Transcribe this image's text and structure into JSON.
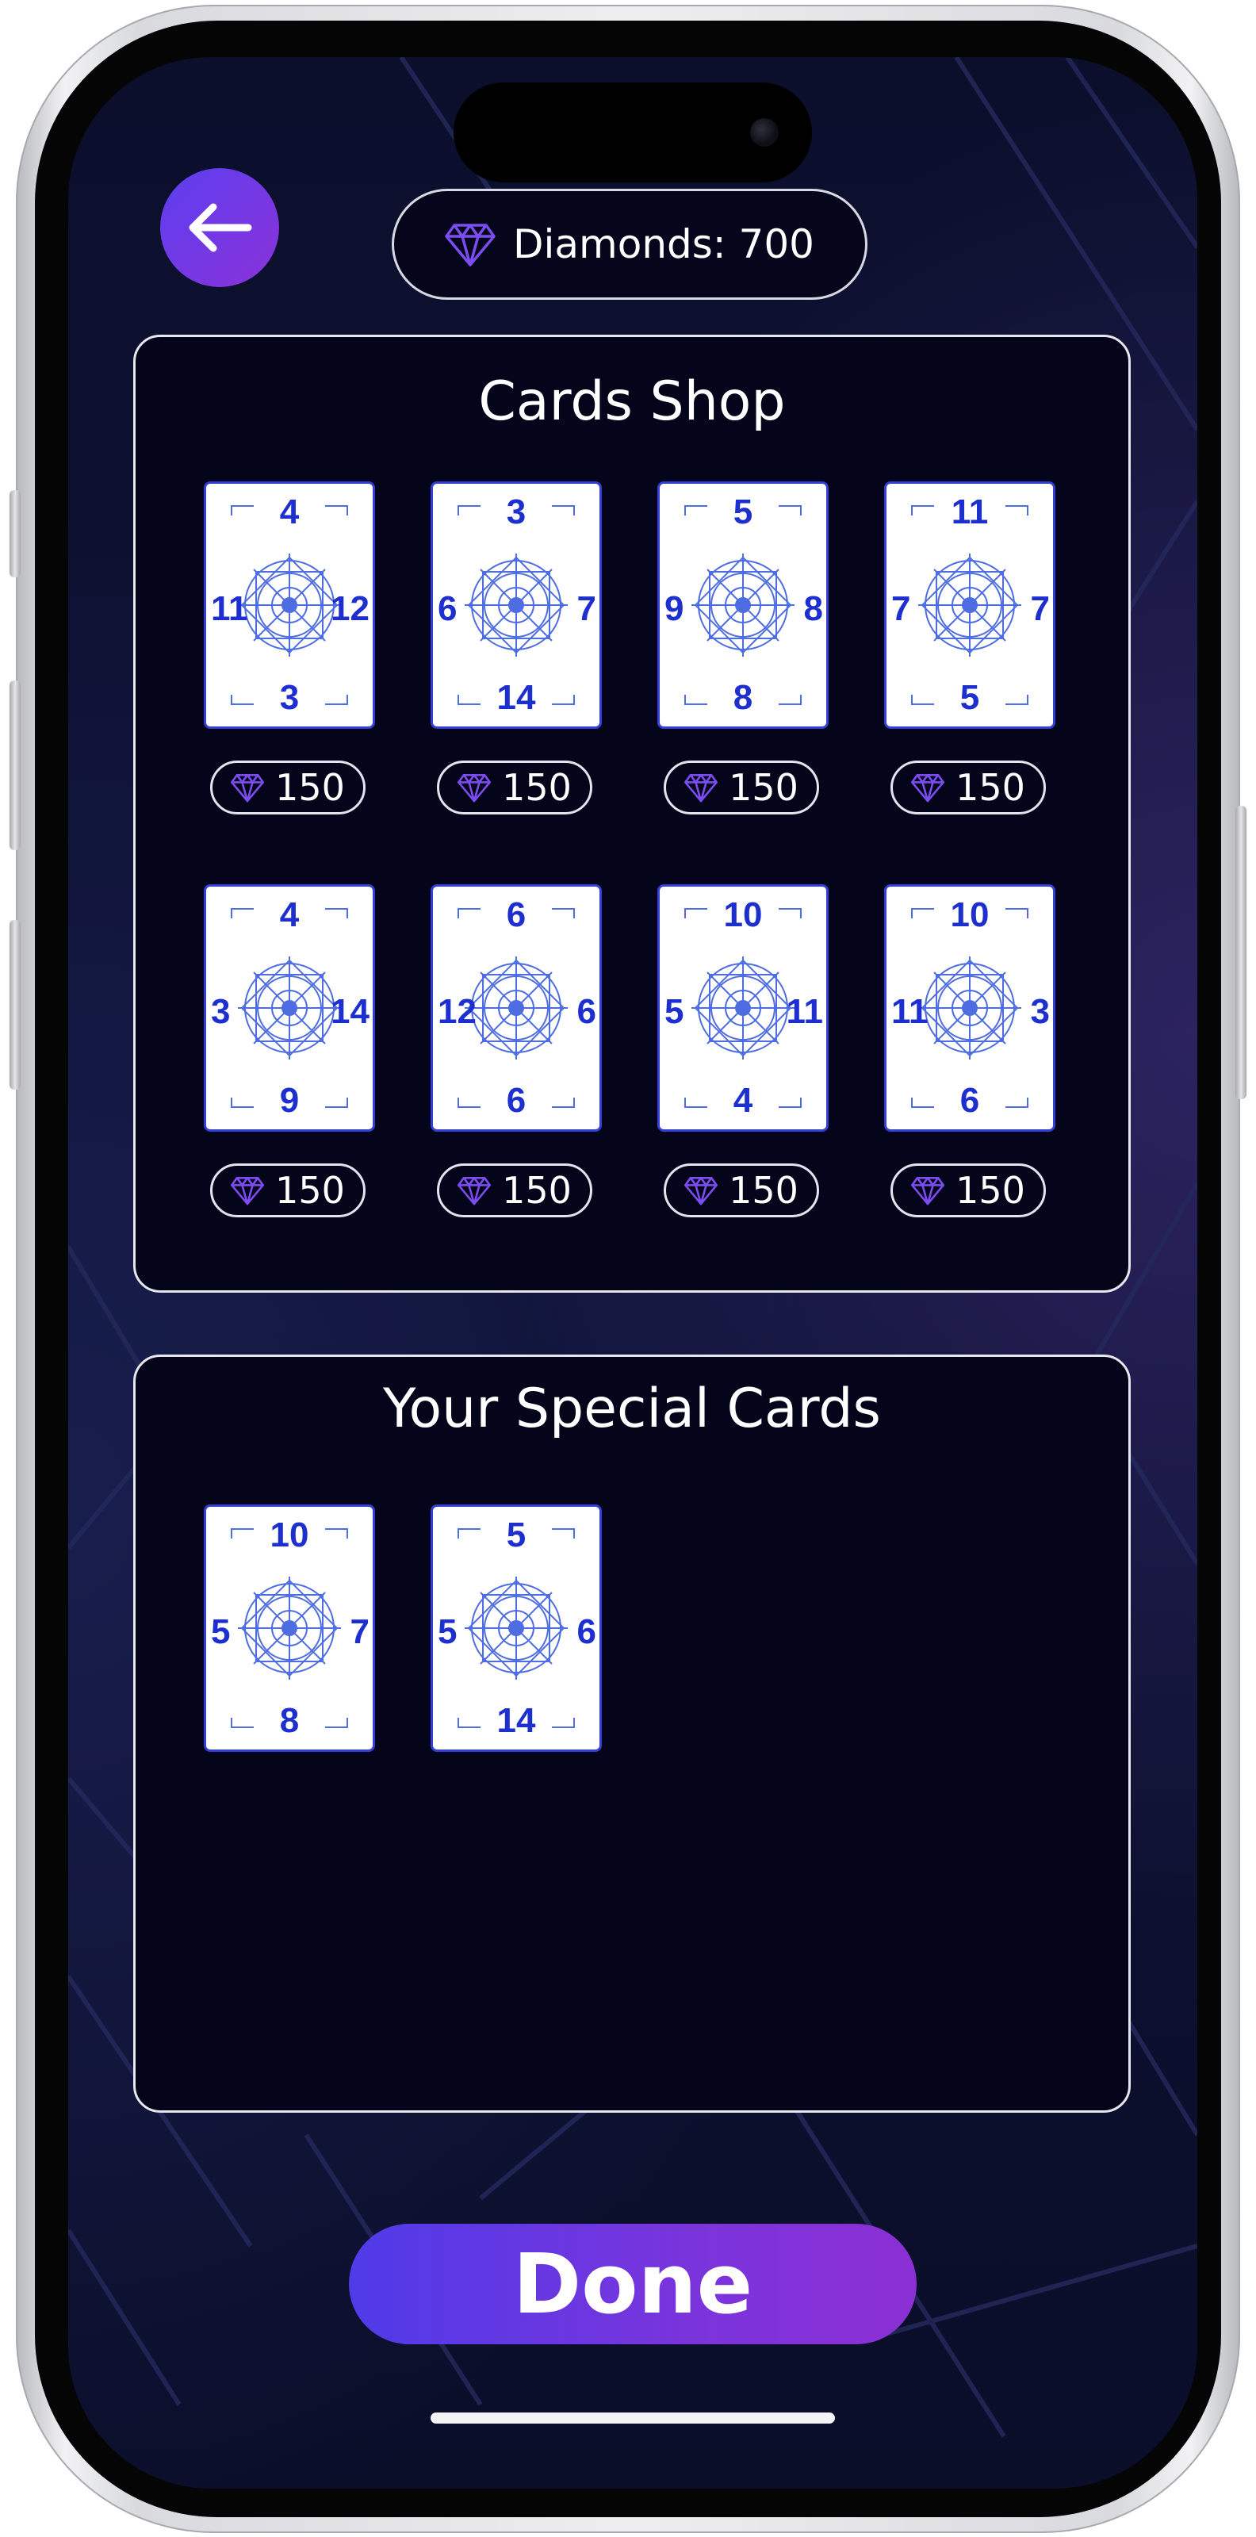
{
  "header": {
    "back_icon": "arrow-left-icon",
    "diamonds_icon": "diamond-icon",
    "diamonds_label": "Diamonds: 700"
  },
  "shop": {
    "title": "Cards Shop",
    "price_icon": "diamond-icon",
    "cards": [
      {
        "top": "4",
        "left": "11",
        "right": "12",
        "bottom": "3",
        "price": "150"
      },
      {
        "top": "3",
        "left": "6",
        "right": "7",
        "bottom": "14",
        "price": "150"
      },
      {
        "top": "5",
        "left": "9",
        "right": "8",
        "bottom": "8",
        "price": "150"
      },
      {
        "top": "11",
        "left": "7",
        "right": "7",
        "bottom": "5",
        "price": "150"
      },
      {
        "top": "4",
        "left": "3",
        "right": "14",
        "bottom": "9",
        "price": "150"
      },
      {
        "top": "6",
        "left": "12",
        "right": "6",
        "bottom": "6",
        "price": "150"
      },
      {
        "top": "10",
        "left": "5",
        "right": "11",
        "bottom": "4",
        "price": "150"
      },
      {
        "top": "10",
        "left": "11",
        "right": "3",
        "bottom": "6",
        "price": "150"
      }
    ]
  },
  "special": {
    "title": "Your Special Cards",
    "cards": [
      {
        "top": "10",
        "left": "5",
        "right": "7",
        "bottom": "8"
      },
      {
        "top": "5",
        "left": "5",
        "right": "6",
        "bottom": "14"
      }
    ]
  },
  "footer": {
    "done_label": "Done"
  },
  "colors": {
    "accent_start": "#5b3ff0",
    "accent_end": "#8b32d8",
    "card_number": "#1e2fcf",
    "panel_bg": "#04041a",
    "background": "#0b0f2c"
  }
}
